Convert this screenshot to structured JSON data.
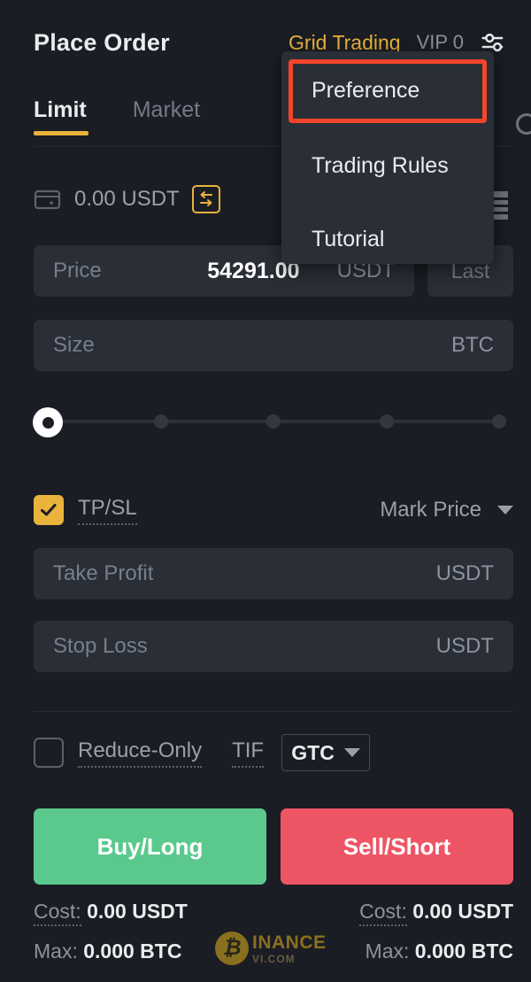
{
  "header": {
    "title": "Place Order",
    "grid_trading_label": "Grid Trading",
    "vip_label": "VIP 0",
    "settings_icon": "sliders-settings-icon",
    "accent_color": "#e9b33c"
  },
  "tabs": [
    {
      "label": "Limit",
      "active": true
    },
    {
      "label": "Market",
      "active": false
    }
  ],
  "wallet": {
    "icon": "wallet-icon",
    "balance": "0.00 USDT",
    "transfer_icon": "transfer-swap-icon",
    "ladder_icon": "order-book-ladder-icon"
  },
  "price": {
    "label": "Price",
    "value": "54291.00",
    "unit": "USDT",
    "last_button": "Last"
  },
  "size": {
    "placeholder": "Size",
    "unit": "BTC",
    "value": ""
  },
  "slider": {
    "value": 0,
    "ticks": [
      0,
      25,
      50,
      75,
      100
    ]
  },
  "tpsl": {
    "checked": true,
    "label": "TP/SL",
    "trigger_type": "Mark Price",
    "caret_icon": "chevron-down-icon",
    "take_profit": {
      "placeholder": "Take Profit",
      "unit": "USDT",
      "value": ""
    },
    "stop_loss": {
      "placeholder": "Stop Loss",
      "unit": "USDT",
      "value": ""
    }
  },
  "order_options": {
    "reduce_only": {
      "label": "Reduce-Only",
      "checked": false
    },
    "tif_label": "TIF",
    "tif_value": "GTC",
    "tif_caret_icon": "chevron-down-icon"
  },
  "actions": {
    "buy_label": "Buy/Long",
    "sell_label": "Sell/Short",
    "buy_color": "#5bc98d",
    "sell_color": "#ed5565"
  },
  "footer": {
    "left": {
      "cost_key": "Cost:",
      "cost_value": "0.00 USDT",
      "max_key": "Max:",
      "max_value": "0.000 BTC"
    },
    "right": {
      "cost_key": "Cost:",
      "cost_value": "0.00 USDT",
      "max_key": "Max:",
      "max_value": "0.000 BTC"
    }
  },
  "watermark": {
    "coin_glyph": "₿",
    "main": "INANCE",
    "sub": "VI.COM"
  },
  "dropdown": {
    "open": true,
    "items": [
      {
        "label": "Preference",
        "highlighted": true
      },
      {
        "label": "Trading Rules",
        "highlighted": false
      },
      {
        "label": "Tutorial",
        "highlighted": false
      }
    ],
    "highlight_color": "#f4452a"
  }
}
